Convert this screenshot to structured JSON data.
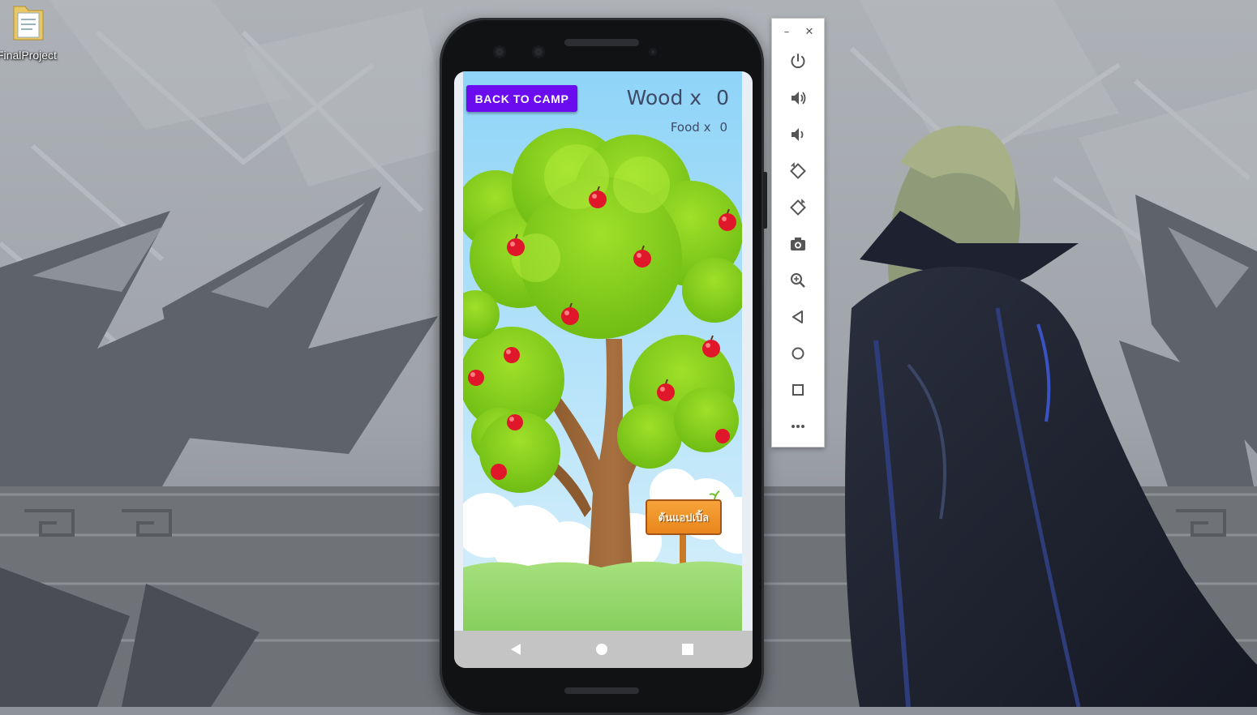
{
  "desktop": {
    "icon_label": "FinalProject"
  },
  "game": {
    "back_button_label": "BACK TO CAMP",
    "wood_label": "Wood x",
    "wood_count": "0",
    "food_label": "Food x",
    "food_count": "0",
    "sign_text": "ต้นแอปเปิ้ล"
  },
  "android_nav": {
    "back": "back-triangle",
    "home": "home-circle",
    "recents": "recents-square"
  },
  "emulator_toolbar": {
    "minimize_label": "–",
    "close_label": "✕",
    "buttons": [
      "power",
      "volume-up",
      "volume-down",
      "rotate-left",
      "rotate-right",
      "screenshot",
      "zoom",
      "back",
      "home",
      "overview",
      "more"
    ]
  },
  "colors": {
    "back_button": "#6a0bf0",
    "counter_text": "#3e4a66",
    "sky": "#a9dcf5",
    "leaves": "#8ccf1a",
    "apple": "#e0162a",
    "grass": "#8fd36a"
  }
}
